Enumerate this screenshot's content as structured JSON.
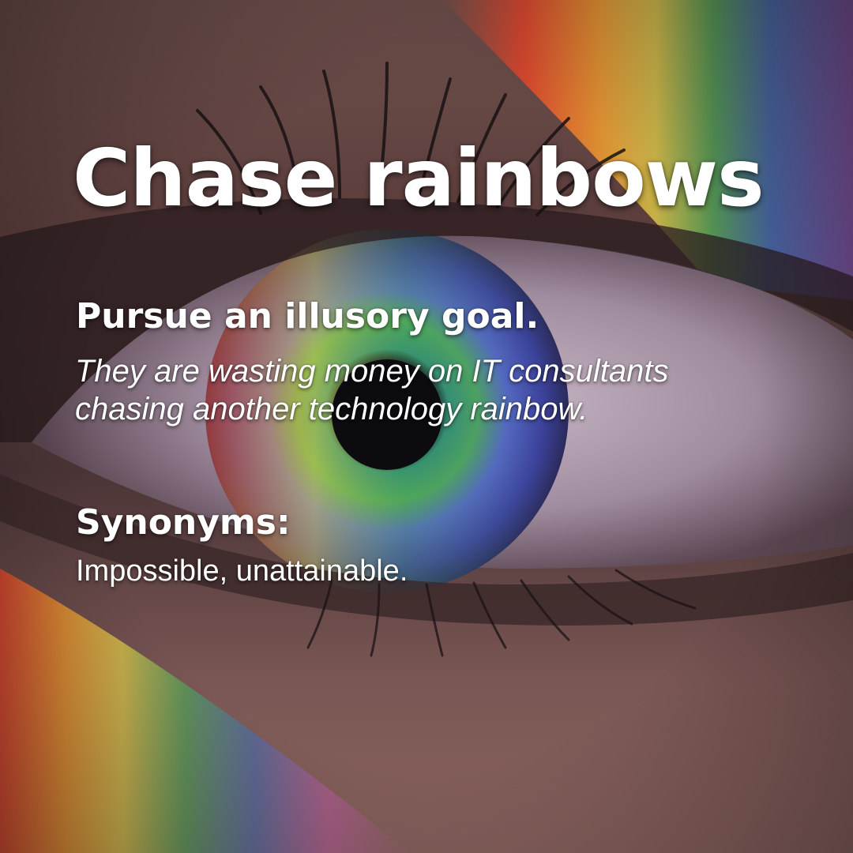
{
  "poster": {
    "title": "Chase rainbows",
    "definition": "Pursue an illusory goal.",
    "example_lines": [
      "They are wasting money on IT consultants",
      "chasing another technology rainbow."
    ],
    "synonyms_heading": "Synonyms:",
    "synonyms": "Impossible, unattainable."
  },
  "colors": {
    "text": "#ffffff",
    "skin": "#7a5652",
    "iris_blue": "#4a4fa8",
    "rainbow": [
      "#e8452a",
      "#f29a2e",
      "#e9d64a",
      "#4fae5a",
      "#3f6fc0",
      "#7a4fb0",
      "#c25aa8"
    ]
  },
  "image": {
    "subject": "close-up-eye-with-rainbow-light"
  }
}
